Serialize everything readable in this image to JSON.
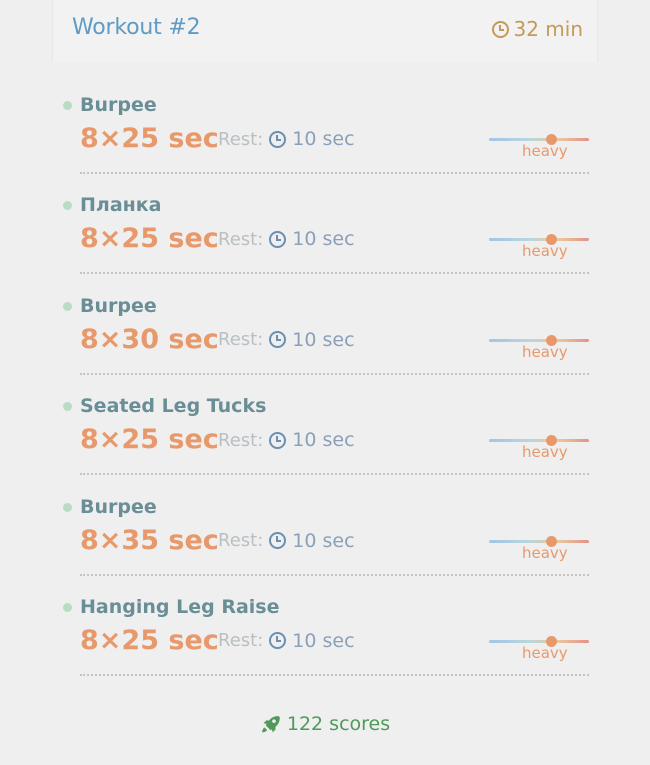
{
  "workout": {
    "title": "Workout #2",
    "duration": "32 min"
  },
  "exercises": [
    {
      "name": "Burpee",
      "sets": "8×25 sec",
      "rest_label": "Rest:",
      "rest_value": "10 sec",
      "intensity_label": "heavy",
      "intensity_level": 0.62
    },
    {
      "name": "Планка",
      "sets": "8×25 sec",
      "rest_label": "Rest:",
      "rest_value": "10 sec",
      "intensity_label": "heavy",
      "intensity_level": 0.62
    },
    {
      "name": "Burpee",
      "sets": "8×30 sec",
      "rest_label": "Rest:",
      "rest_value": "10 sec",
      "intensity_label": "heavy",
      "intensity_level": 0.62
    },
    {
      "name": "Seated Leg Tucks",
      "sets": "8×25 sec",
      "rest_label": "Rest:",
      "rest_value": "10 sec",
      "intensity_label": "heavy",
      "intensity_level": 0.62
    },
    {
      "name": "Burpee",
      "sets": "8×35 sec",
      "rest_label": "Rest:",
      "rest_value": "10 sec",
      "intensity_label": "heavy",
      "intensity_level": 0.62
    },
    {
      "name": "Hanging Leg Raise",
      "sets": "8×25 sec",
      "rest_label": "Rest:",
      "rest_value": "10 sec",
      "intensity_label": "heavy",
      "intensity_level": 0.62
    }
  ],
  "footer": {
    "scores": "122 scores",
    "icon": "rocket-icon"
  },
  "colors": {
    "title": "#5f9bc4",
    "duration": "#c59a57",
    "accent": "#e8996b",
    "exercise_name": "#6a8e96",
    "scores": "#4f9a5a"
  }
}
